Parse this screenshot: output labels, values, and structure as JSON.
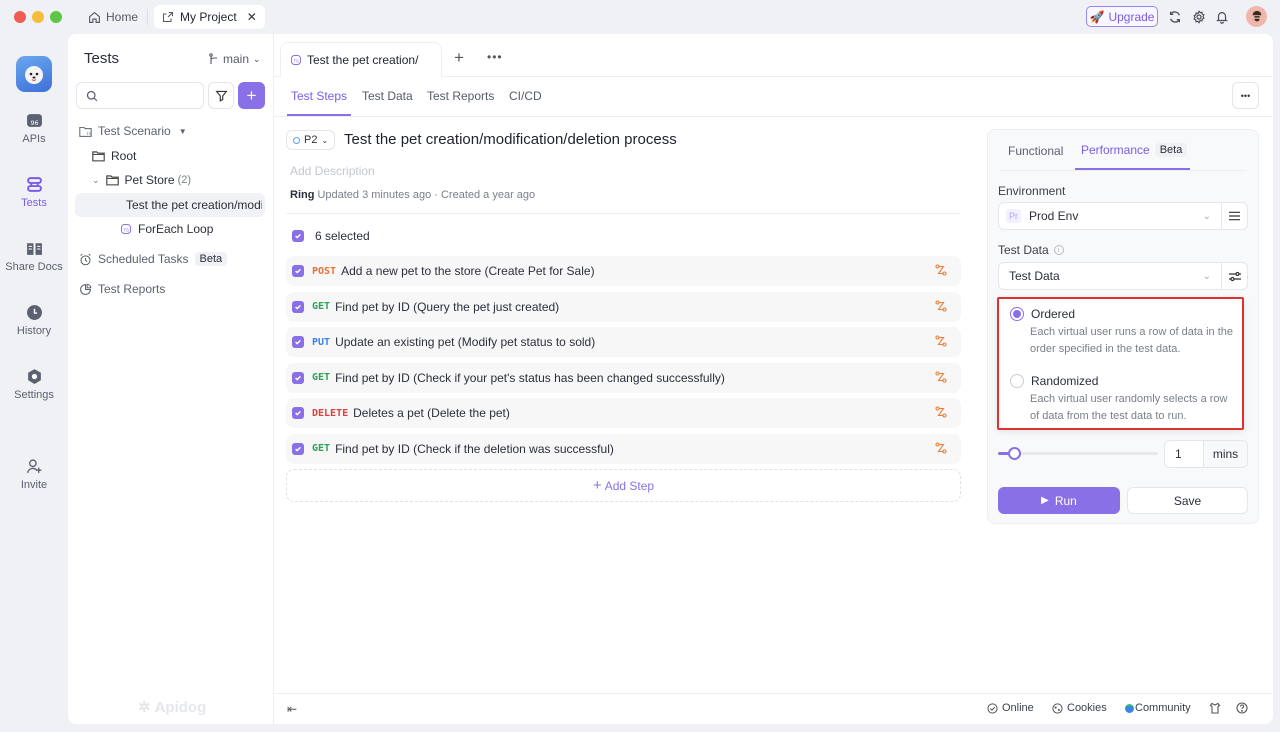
{
  "window": {
    "tabs": [
      {
        "label": "Home",
        "icon": "home-icon"
      },
      {
        "label": "My Project",
        "icon": "external-link-icon",
        "active": true
      }
    ],
    "upgrade_label": "Upgrade"
  },
  "leftnav": {
    "items": [
      {
        "label": "APIs",
        "icon": "api-icon"
      },
      {
        "label": "Tests",
        "icon": "tests-icon",
        "active": true
      },
      {
        "label": "Share Docs",
        "icon": "book-icon"
      },
      {
        "label": "History",
        "icon": "clock-icon"
      },
      {
        "label": "Settings",
        "icon": "settings-icon"
      },
      {
        "label": "Invite",
        "icon": "invite-user-icon"
      }
    ],
    "watermark": "Apidog"
  },
  "sidepanel": {
    "title": "Tests",
    "branch": "main",
    "search_placeholder": "",
    "tree": {
      "scenario": "Test Scenario",
      "root": "Root",
      "folder": "Pet Store",
      "folder_count": "(2)",
      "items": [
        "Test the pet creation/modification/deletion process",
        "ForEach Loop"
      ],
      "scheduled": "Scheduled Tasks",
      "scheduled_badge": "Beta",
      "reports": "Test Reports"
    }
  },
  "main": {
    "doc_tab": "Test the pet creation/modification/deletion process",
    "subtabs": [
      "Test Steps",
      "Test Data",
      "Test Reports",
      "CI/CD"
    ],
    "priority": "P2",
    "title": "Test the pet creation/modification/deletion process",
    "description_placeholder": "Add Description",
    "author": "Ring",
    "meta": "Updated 3 minutes ago · Created a year ago",
    "selected_label": "6 selected",
    "steps": [
      {
        "method": "POST",
        "color": "#e8703a",
        "text": "Add a new pet to the store (Create Pet for Sale)"
      },
      {
        "method": "GET",
        "color": "#2fa05a",
        "text": "Find pet by ID (Query the pet just created)"
      },
      {
        "method": "PUT",
        "color": "#3a86e8",
        "text": "Update an existing pet (Modify pet status to sold)"
      },
      {
        "method": "GET",
        "color": "#2fa05a",
        "text": "Find pet by ID (Check if your pet's status has been changed successfully)"
      },
      {
        "method": "DELETE",
        "color": "#e03e3e",
        "text": "Deletes a pet (Delete the pet)"
      },
      {
        "method": "GET",
        "color": "#2fa05a",
        "text": "Find pet by ID (Check if the deletion was successful)"
      }
    ],
    "add_step": "Add Step"
  },
  "runpanel": {
    "tabs": [
      "Functional",
      "Performance"
    ],
    "performance_badge": "Beta",
    "environment_label": "Environment",
    "environment_badge": "Pr",
    "environment_value": "Prod Env",
    "testdata_label": "Test Data",
    "testdata_value": "Test Data",
    "options": [
      {
        "label": "Ordered",
        "desc": "Each virtual user runs a row of data in the order specified in the test data.",
        "selected": true
      },
      {
        "label": "Randomized",
        "desc": "Each virtual user randomly selects a row of data from the test data to run.",
        "selected": false
      }
    ],
    "duration_value": "1",
    "duration_unit": "mins",
    "run_label": "Run",
    "save_label": "Save"
  },
  "footer": {
    "online": "Online",
    "cookies": "Cookies",
    "community": "Community"
  },
  "colors": {
    "accent": "#8a70e6",
    "highlight_border": "#e03131"
  }
}
